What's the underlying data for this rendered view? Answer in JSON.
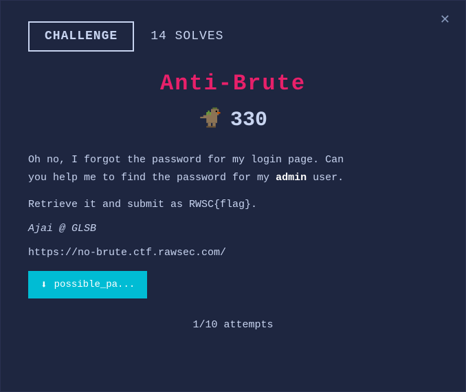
{
  "modal": {
    "close_label": "✕"
  },
  "top_bar": {
    "challenge_label": "CHALLENGE",
    "solves_label": "14 SOLVES"
  },
  "challenge": {
    "title": "Anti-Brute",
    "points": "330",
    "description_part1": "Oh no, I forgot the password for my login page. Can",
    "description_part2": "you help me to find the password for my",
    "admin_word": "admin",
    "description_part3": "user.",
    "retrieve_text": "Retrieve it and submit as RWSC{flag}.",
    "author": "Ajai @ GLSB",
    "link": "https://no-brute.ctf.rawsec.com/",
    "download_label": "possible_pa...",
    "attempts_text": "1/10 attempts"
  }
}
